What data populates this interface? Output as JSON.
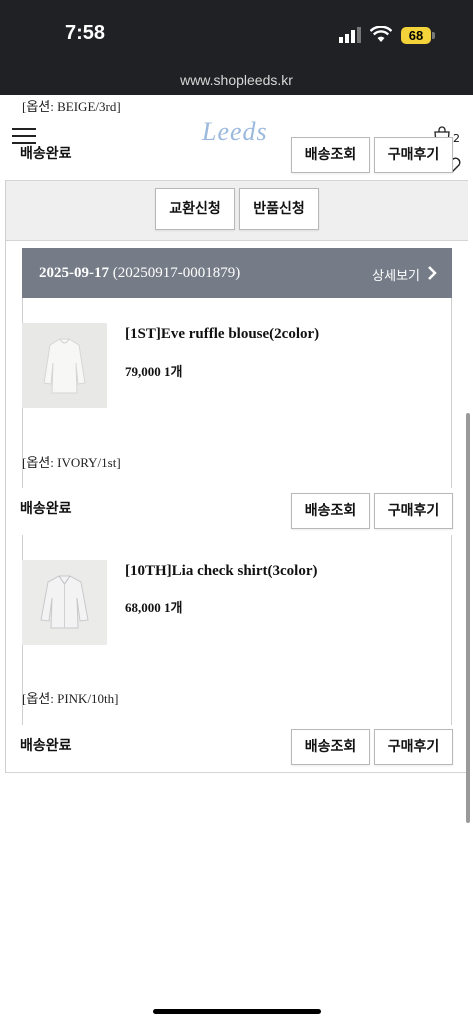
{
  "status_bar": {
    "time": "7:58",
    "battery": "68",
    "url": "www.shopleeds.kr"
  },
  "header": {
    "logo": "Leeds",
    "cart_count": "2"
  },
  "top_item": {
    "option": "[옵션: BEIGE/3rd]",
    "status": "배송완료",
    "track_label": "배송조회",
    "review_label": "구매후기"
  },
  "actions": {
    "exchange_label": "교환신청",
    "return_label": "반품신청"
  },
  "order": {
    "date": "2025-09-17",
    "number": "(20250917-0001879)",
    "detail_label": "상세보기"
  },
  "items": [
    {
      "name": "[1ST]Eve ruffle blouse(2color)",
      "price": "79,000 1개",
      "option": "[옵션: IVORY/1st]",
      "status": "배송완료",
      "track_label": "배송조회",
      "review_label": "구매후기"
    },
    {
      "name": "[10TH]Lia check shirt(3color)",
      "price": "68,000 1개",
      "option": "[옵션: PINK/10th]",
      "status": "배송완료",
      "track_label": "배송조회",
      "review_label": "구매후기"
    }
  ]
}
